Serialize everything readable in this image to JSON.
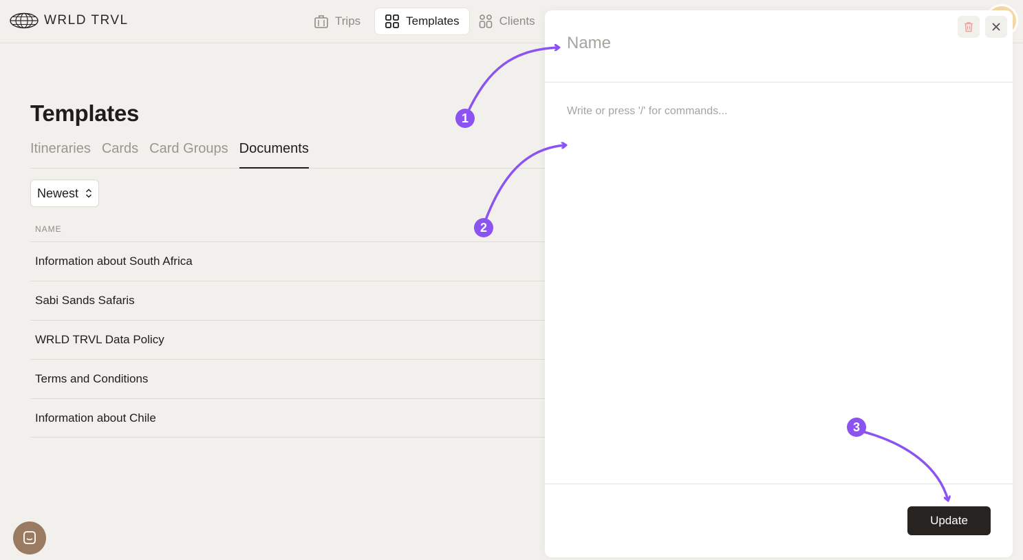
{
  "brand": {
    "name": "WRLD TRVL"
  },
  "nav": {
    "items": [
      {
        "label": "Trips",
        "icon": "suitcase-icon",
        "active": false
      },
      {
        "label": "Templates",
        "icon": "grid-icon",
        "active": true
      },
      {
        "label": "Clients",
        "icon": "people-icon",
        "active": false
      }
    ]
  },
  "page": {
    "title": "Templates",
    "tabs": [
      {
        "label": "Itineraries",
        "active": false
      },
      {
        "label": "Cards",
        "active": false
      },
      {
        "label": "Card Groups",
        "active": false
      },
      {
        "label": "Documents",
        "active": true
      }
    ],
    "sort": {
      "selected": "Newest"
    },
    "table": {
      "column_header": "NAME",
      "rows": [
        "Information about South Africa",
        "Sabi Sands Safaris",
        "WRLD TRVL Data Policy",
        "Terms and Conditions",
        "Information about Chile"
      ]
    }
  },
  "drawer": {
    "name_placeholder": "Name",
    "name_value": "",
    "editor_placeholder": "Write or press '/' for commands...",
    "update_label": "Update"
  },
  "annotations": {
    "badges": [
      "1",
      "2",
      "3"
    ],
    "accent_color": "#8a53f2"
  }
}
